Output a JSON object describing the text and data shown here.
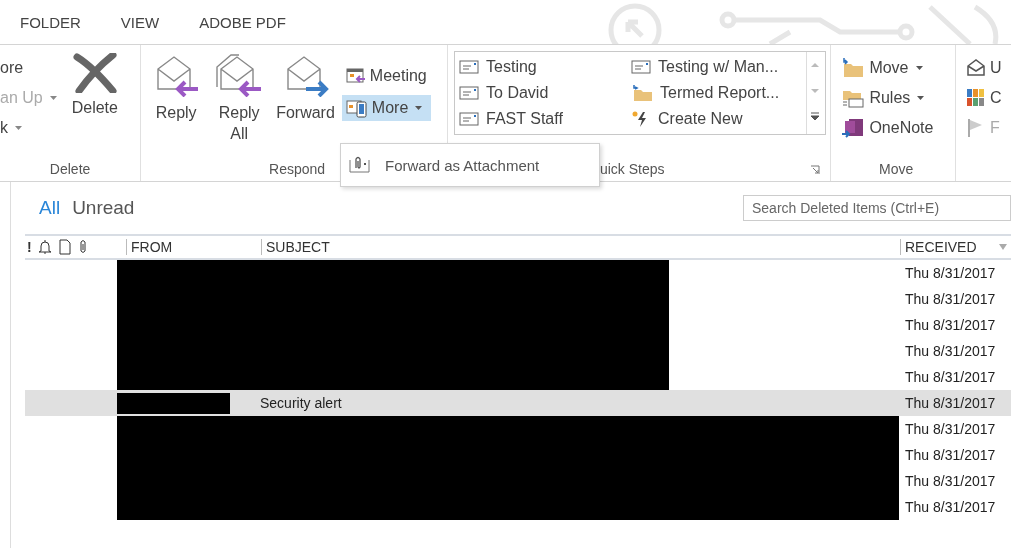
{
  "tabs": [
    {
      "label": "FOLDER",
      "selected": false
    },
    {
      "label": "VIEW",
      "selected": false
    },
    {
      "label": "ADOBE PDF",
      "selected": false
    }
  ],
  "ribbon": {
    "delete_group": {
      "small_items": [
        {
          "label": "ore",
          "disabled": false,
          "dropdown": false
        },
        {
          "label": "an Up",
          "disabled": true,
          "dropdown": true
        },
        {
          "label": "k",
          "disabled": false,
          "dropdown": true
        }
      ],
      "delete_button": "Delete",
      "label": "Delete"
    },
    "respond_group": {
      "buttons": [
        {
          "label": "Reply",
          "kind": "reply"
        },
        {
          "label": "Reply All",
          "kind": "reply-all"
        },
        {
          "label": "Forward",
          "kind": "forward"
        }
      ],
      "meeting": "Meeting",
      "more": {
        "label": "More",
        "expanded": true
      },
      "label": "Respond"
    },
    "quick_steps": {
      "items": [
        {
          "label": "Testing",
          "kind": "mail"
        },
        {
          "label": "Testing w/ Man...",
          "kind": "mail"
        },
        {
          "label": "To David",
          "kind": "mail"
        },
        {
          "label": "Termed Report...",
          "kind": "folder"
        },
        {
          "label": "FAST Staff",
          "kind": "mail"
        },
        {
          "label": "Create New",
          "kind": "new"
        }
      ],
      "label": "uick Steps"
    },
    "move_group": {
      "items": [
        {
          "label": "Move",
          "kind": "move",
          "dropdown": true
        },
        {
          "label": "Rules",
          "kind": "rules",
          "dropdown": true
        },
        {
          "label": "OneNote",
          "kind": "onenote",
          "dropdown": false
        }
      ],
      "label": "Move"
    },
    "tags_group": {
      "items": [
        {
          "label": "U",
          "kind": "envelope"
        },
        {
          "label": "C",
          "kind": "grid"
        },
        {
          "label": "F",
          "kind": "flag"
        }
      ]
    }
  },
  "more_menu": {
    "items": [
      {
        "label": "Forward as Attachment"
      }
    ]
  },
  "filters": [
    {
      "label": "All",
      "selected": true
    },
    {
      "label": "Unread",
      "selected": false
    }
  ],
  "search": {
    "placeholder": "Search Deleted Items (Ctrl+E)"
  },
  "table": {
    "columns": [
      "!",
      "FROM",
      "SUBJECT",
      "RECEIVED"
    ],
    "rows": [
      {
        "received": "Thu 8/31/2017",
        "selected": false
      },
      {
        "received": "Thu 8/31/2017",
        "selected": false
      },
      {
        "received": "Thu 8/31/2017",
        "selected": false
      },
      {
        "received": "Thu 8/31/2017",
        "selected": false
      },
      {
        "received": "Thu 8/31/2017",
        "selected": false
      },
      {
        "subject": "Security alert",
        "received": "Thu 8/31/2017",
        "selected": true
      },
      {
        "received": "Thu 8/31/2017",
        "selected": false
      },
      {
        "received": "Thu 8/31/2017",
        "selected": false
      },
      {
        "received": "Thu 8/31/2017",
        "selected": false
      },
      {
        "received": "Thu 8/31/2017",
        "selected": false
      }
    ]
  }
}
